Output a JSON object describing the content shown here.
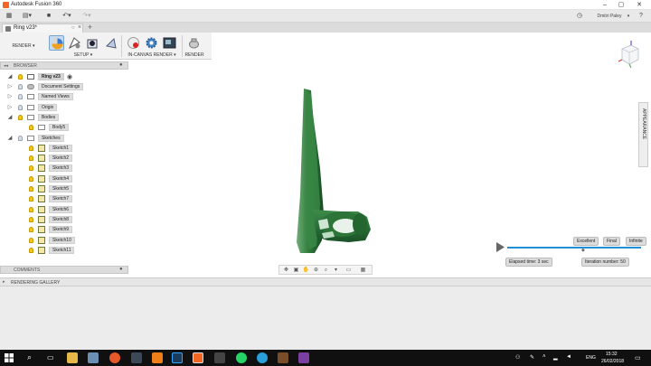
{
  "window": {
    "title": "Autodesk Fusion 360"
  },
  "quick_access": {
    "user_name": "Dmitri Paley",
    "icons": [
      "grid-icon",
      "file-icon",
      "save-icon",
      "undo-icon",
      "redo-icon",
      "clock-icon",
      "help-icon"
    ]
  },
  "document_tab": {
    "label": "Ring v23*"
  },
  "toolbar": {
    "workspace_label": "RENDER",
    "groups": [
      {
        "label": "SETUP"
      },
      {
        "label": "IN-CANVAS RENDER"
      },
      {
        "label": "RENDER"
      }
    ]
  },
  "browser": {
    "header": "BROWSER",
    "root": "Ring v23",
    "items": [
      {
        "label": "Document Settings",
        "level": 1,
        "icon": "gear-icon"
      },
      {
        "label": "Named Views",
        "level": 1,
        "icon": "folder-icon"
      },
      {
        "label": "Origin",
        "level": 1,
        "icon": "folder-icon"
      },
      {
        "label": "Bodies",
        "level": 1,
        "icon": "folder-icon"
      },
      {
        "label": "Body5",
        "level": 2,
        "icon": "body-icon"
      },
      {
        "label": "Sketches",
        "level": 1,
        "icon": "folder-icon"
      },
      {
        "label": "Sketch1",
        "level": 2,
        "icon": "sketch-icon"
      },
      {
        "label": "Sketch2",
        "level": 2,
        "icon": "sketch-icon"
      },
      {
        "label": "Sketch3",
        "level": 2,
        "icon": "sketch-icon"
      },
      {
        "label": "Sketch4",
        "level": 2,
        "icon": "sketch-icon"
      },
      {
        "label": "Sketch5",
        "level": 2,
        "icon": "sketch-icon"
      },
      {
        "label": "Sketch7",
        "level": 2,
        "icon": "sketch-icon"
      },
      {
        "label": "Sketch6",
        "level": 2,
        "icon": "sketch-icon"
      },
      {
        "label": "Sketch8",
        "level": 2,
        "icon": "sketch-icon"
      },
      {
        "label": "Sketch9",
        "level": 2,
        "icon": "sketch-icon"
      },
      {
        "label": "Sketch10",
        "level": 2,
        "icon": "sketch-icon"
      },
      {
        "label": "Sketch11",
        "level": 2,
        "icon": "sketch-icon"
      }
    ]
  },
  "comments": {
    "label": "COMMENTS"
  },
  "gallery": {
    "label": "RENDERING GALLERY"
  },
  "appearance": {
    "label": "APPEARANCE"
  },
  "render_quality": {
    "levels": [
      "Excellent",
      "Final",
      "Infinite"
    ],
    "elapsed": "Elapsed time: 3 sec",
    "iteration": "Iteration number: 50"
  },
  "taskbar": {
    "time": "15:32",
    "date": "26/02/2018",
    "language": "ENG"
  },
  "colors": {
    "accent": "#1f8fd6",
    "model_green": "#2f7a3a"
  }
}
